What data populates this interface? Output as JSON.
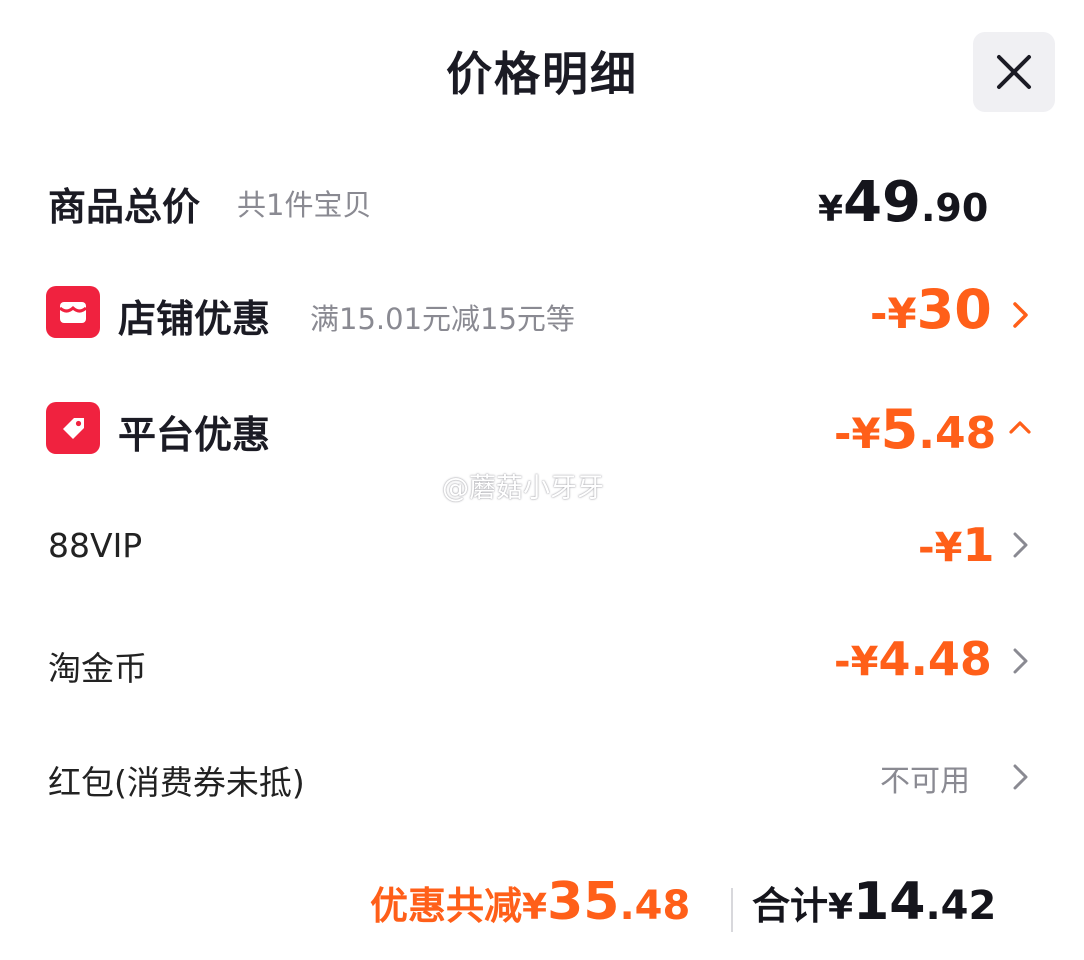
{
  "header": {
    "title": "价格明细"
  },
  "goods_total": {
    "label": "商品总价",
    "count_text": "共1件宝贝",
    "currency": "¥",
    "amount_int": "49",
    "amount_dec": ".90"
  },
  "store_discount": {
    "label": "店铺优惠",
    "detail": "满15.01元减15元等",
    "prefix": "-¥",
    "amount": "30",
    "icon": "storefront-icon"
  },
  "platform_discount": {
    "label": "平台优惠",
    "prefix": "-¥",
    "amount_int": "5",
    "amount_dec": ".48",
    "icon": "tag-icon",
    "expanded": true
  },
  "platform_items": [
    {
      "label": "88VIP",
      "prefix": "-¥",
      "amount": "1"
    },
    {
      "label": "淘金币",
      "prefix": "-¥",
      "amount": "4.48"
    },
    {
      "label": "红包(消费券未抵)",
      "status": "不可用"
    }
  ],
  "footer": {
    "discount_label": "优惠共减",
    "discount_currency": "¥",
    "discount_int": "35",
    "discount_dec": ".48",
    "total_label": "合计",
    "total_currency": "¥",
    "total_int": "14",
    "total_dec": ".42"
  },
  "watermark": "@蘑菇小牙牙",
  "colors": {
    "accent": "#ff5f19",
    "badge": "#f0223f",
    "text": "#1b1b24",
    "muted": "#8a8a92"
  }
}
